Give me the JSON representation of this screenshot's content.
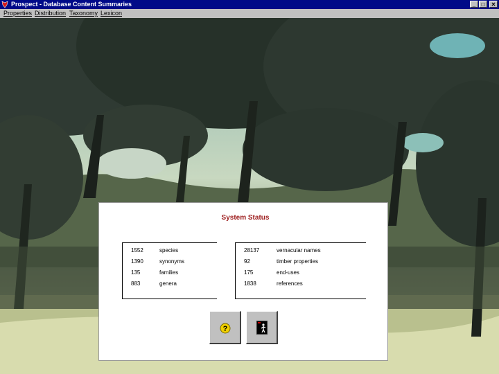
{
  "window": {
    "title": "Prospect - Database Content Summaries",
    "controls": {
      "minimize": "_",
      "maximize": "□",
      "close": "✕"
    }
  },
  "menu": [
    "Properties",
    "Distribution",
    "Taxonomy",
    "Lexicon"
  ],
  "status": {
    "title": "System Status",
    "left": [
      {
        "num": "1552",
        "label": "species"
      },
      {
        "num": "1390",
        "label": "synonyms"
      },
      {
        "num": "135",
        "label": "families"
      },
      {
        "num": "883",
        "label": "genera"
      }
    ],
    "right": [
      {
        "num": "28137",
        "label": "vernacular names"
      },
      {
        "num": "92",
        "label": "timber properties"
      },
      {
        "num": "175",
        "label": "end-uses"
      },
      {
        "num": "1838",
        "label": "references"
      }
    ]
  },
  "buttons": {
    "help_icon": "help-icon",
    "exit_icon": "exit-door-icon"
  }
}
